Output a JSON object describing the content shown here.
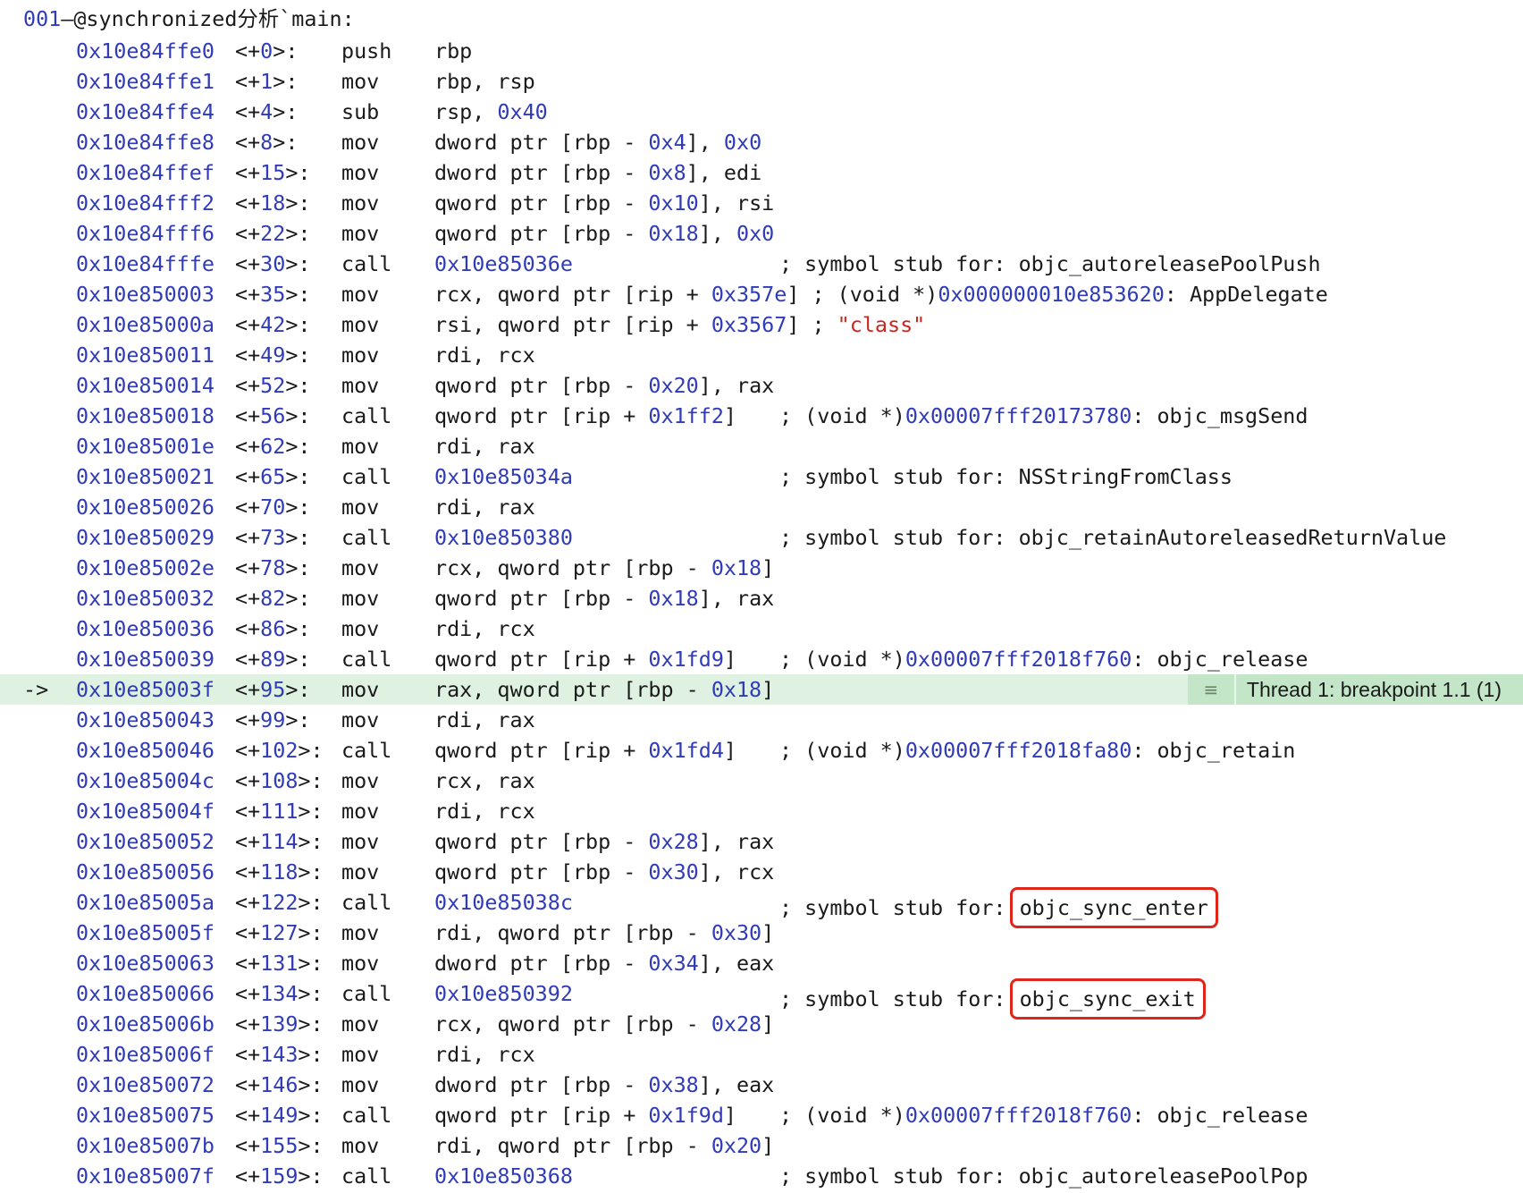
{
  "header": {
    "prefix": "001",
    "label": "—@synchronized分析`main:"
  },
  "current_arrow": "->",
  "breakpoint": {
    "icon": "≡",
    "label": "Thread 1: breakpoint 1.1 (1)"
  },
  "lines": [
    {
      "addr": "0x10e84ffe0",
      "off": "0",
      "mn": "push",
      "op": [
        [
          "rbp"
        ]
      ],
      "cm": []
    },
    {
      "addr": "0x10e84ffe1",
      "off": "1",
      "mn": "mov",
      "op": [
        [
          "rbp, rsp"
        ]
      ],
      "cm": []
    },
    {
      "addr": "0x10e84ffe4",
      "off": "4",
      "mn": "sub",
      "op": [
        [
          "rsp, "
        ],
        [
          "0x40",
          "h"
        ]
      ],
      "cm": []
    },
    {
      "addr": "0x10e84ffe8",
      "off": "8",
      "mn": "mov",
      "op": [
        [
          "dword ptr [rbp - "
        ],
        [
          "0x4",
          "h"
        ],
        [
          "], "
        ],
        [
          "0x0",
          "h"
        ]
      ],
      "cm": []
    },
    {
      "addr": "0x10e84ffef",
      "off": "15",
      "mn": "mov",
      "op": [
        [
          "dword ptr [rbp - "
        ],
        [
          "0x8",
          "h"
        ],
        [
          "], edi"
        ]
      ],
      "cm": []
    },
    {
      "addr": "0x10e84fff2",
      "off": "18",
      "mn": "mov",
      "op": [
        [
          "qword ptr [rbp - "
        ],
        [
          "0x10",
          "h"
        ],
        [
          "], rsi"
        ]
      ],
      "cm": []
    },
    {
      "addr": "0x10e84fff6",
      "off": "22",
      "mn": "mov",
      "op": [
        [
          "qword ptr [rbp - "
        ],
        [
          "0x18",
          "h"
        ],
        [
          "], "
        ],
        [
          "0x0",
          "h"
        ]
      ],
      "cm": []
    },
    {
      "addr": "0x10e84fffe",
      "off": "30",
      "mn": "call",
      "op": [
        [
          "0x10e85036e",
          "h"
        ]
      ],
      "cm": [
        [
          "; symbol stub for: objc_autoreleasePoolPush"
        ]
      ]
    },
    {
      "addr": "0x10e850003",
      "off": "35",
      "mn": "mov",
      "op": [
        [
          "rcx, qword ptr [rip + "
        ],
        [
          "0x357e",
          "h"
        ],
        [
          "] ; (void *)"
        ],
        [
          "0x000000010e853620",
          "h"
        ],
        [
          ": AppDelegate"
        ]
      ],
      "cm": []
    },
    {
      "addr": "0x10e85000a",
      "off": "42",
      "mn": "mov",
      "op": [
        [
          "rsi, qword ptr [rip + "
        ],
        [
          "0x3567",
          "h"
        ],
        [
          "] ; "
        ],
        [
          "\"class\"",
          "s"
        ]
      ],
      "cm": []
    },
    {
      "addr": "0x10e850011",
      "off": "49",
      "mn": "mov",
      "op": [
        [
          "rdi, rcx"
        ]
      ],
      "cm": []
    },
    {
      "addr": "0x10e850014",
      "off": "52",
      "mn": "mov",
      "op": [
        [
          "qword ptr [rbp - "
        ],
        [
          "0x20",
          "h"
        ],
        [
          "], rax"
        ]
      ],
      "cm": []
    },
    {
      "addr": "0x10e850018",
      "off": "56",
      "mn": "call",
      "op": [
        [
          "qword ptr [rip + "
        ],
        [
          "0x1ff2",
          "h"
        ],
        [
          "]"
        ]
      ],
      "cm": [
        [
          "; (void *)"
        ],
        [
          "0x00007fff20173780",
          "h"
        ],
        [
          ": objc_msgSend"
        ]
      ]
    },
    {
      "addr": "0x10e85001e",
      "off": "62",
      "mn": "mov",
      "op": [
        [
          "rdi, rax"
        ]
      ],
      "cm": []
    },
    {
      "addr": "0x10e850021",
      "off": "65",
      "mn": "call",
      "op": [
        [
          "0x10e85034a",
          "h"
        ]
      ],
      "cm": [
        [
          "; symbol stub for: NSStringFromClass"
        ]
      ]
    },
    {
      "addr": "0x10e850026",
      "off": "70",
      "mn": "mov",
      "op": [
        [
          "rdi, rax"
        ]
      ],
      "cm": []
    },
    {
      "addr": "0x10e850029",
      "off": "73",
      "mn": "call",
      "op": [
        [
          "0x10e850380",
          "h"
        ]
      ],
      "cm": [
        [
          "; symbol stub for: objc_retainAutoreleasedReturnValue"
        ]
      ]
    },
    {
      "addr": "0x10e85002e",
      "off": "78",
      "mn": "mov",
      "op": [
        [
          "rcx, qword ptr [rbp - "
        ],
        [
          "0x18",
          "h"
        ],
        [
          "]"
        ]
      ],
      "cm": []
    },
    {
      "addr": "0x10e850032",
      "off": "82",
      "mn": "mov",
      "op": [
        [
          "qword ptr [rbp - "
        ],
        [
          "0x18",
          "h"
        ],
        [
          "], rax"
        ]
      ],
      "cm": []
    },
    {
      "addr": "0x10e850036",
      "off": "86",
      "mn": "mov",
      "op": [
        [
          "rdi, rcx"
        ]
      ],
      "cm": []
    },
    {
      "addr": "0x10e850039",
      "off": "89",
      "mn": "call",
      "op": [
        [
          "qword ptr [rip + "
        ],
        [
          "0x1fd9",
          "h"
        ],
        [
          "]"
        ]
      ],
      "cm": [
        [
          "; (void *)"
        ],
        [
          "0x00007fff2018f760",
          "h"
        ],
        [
          ": objc_release"
        ]
      ]
    },
    {
      "addr": "0x10e85003f",
      "off": "95",
      "mn": "mov",
      "op": [
        [
          "rax, qword ptr [rbp - "
        ],
        [
          "0x18",
          "h"
        ],
        [
          "]"
        ]
      ],
      "cm": [],
      "current": true
    },
    {
      "addr": "0x10e850043",
      "off": "99",
      "mn": "mov",
      "op": [
        [
          "rdi, rax"
        ]
      ],
      "cm": []
    },
    {
      "addr": "0x10e850046",
      "off": "102",
      "mn": "call",
      "op": [
        [
          "qword ptr [rip + "
        ],
        [
          "0x1fd4",
          "h"
        ],
        [
          "]"
        ]
      ],
      "cm": [
        [
          "; (void *)"
        ],
        [
          "0x00007fff2018fa80",
          "h"
        ],
        [
          ": objc_retain"
        ]
      ]
    },
    {
      "addr": "0x10e85004c",
      "off": "108",
      "mn": "mov",
      "op": [
        [
          "rcx, rax"
        ]
      ],
      "cm": []
    },
    {
      "addr": "0x10e85004f",
      "off": "111",
      "mn": "mov",
      "op": [
        [
          "rdi, rcx"
        ]
      ],
      "cm": []
    },
    {
      "addr": "0x10e850052",
      "off": "114",
      "mn": "mov",
      "op": [
        [
          "qword ptr [rbp - "
        ],
        [
          "0x28",
          "h"
        ],
        [
          "], rax"
        ]
      ],
      "cm": []
    },
    {
      "addr": "0x10e850056",
      "off": "118",
      "mn": "mov",
      "op": [
        [
          "qword ptr [rbp - "
        ],
        [
          "0x30",
          "h"
        ],
        [
          "], rcx"
        ]
      ],
      "cm": []
    },
    {
      "addr": "0x10e85005a",
      "off": "122",
      "mn": "call",
      "op": [
        [
          "0x10e85038c",
          "h"
        ]
      ],
      "cm": [
        [
          "; symbol stub for: "
        ],
        [
          "objc_sync_enter",
          "hl"
        ]
      ]
    },
    {
      "addr": "0x10e85005f",
      "off": "127",
      "mn": "mov",
      "op": [
        [
          "rdi, qword ptr [rbp - "
        ],
        [
          "0x30",
          "h"
        ],
        [
          "]"
        ]
      ],
      "cm": []
    },
    {
      "addr": "0x10e850063",
      "off": "131",
      "mn": "mov",
      "op": [
        [
          "dword ptr [rbp - "
        ],
        [
          "0x34",
          "h"
        ],
        [
          "], eax"
        ]
      ],
      "cm": []
    },
    {
      "addr": "0x10e850066",
      "off": "134",
      "mn": "call",
      "op": [
        [
          "0x10e850392",
          "h"
        ]
      ],
      "cm": [
        [
          "; symbol stub for: "
        ],
        [
          "objc_sync_exit",
          "hl"
        ]
      ]
    },
    {
      "addr": "0x10e85006b",
      "off": "139",
      "mn": "mov",
      "op": [
        [
          "rcx, qword ptr [rbp - "
        ],
        [
          "0x28",
          "h"
        ],
        [
          "]"
        ]
      ],
      "cm": []
    },
    {
      "addr": "0x10e85006f",
      "off": "143",
      "mn": "mov",
      "op": [
        [
          "rdi, rcx"
        ]
      ],
      "cm": []
    },
    {
      "addr": "0x10e850072",
      "off": "146",
      "mn": "mov",
      "op": [
        [
          "dword ptr [rbp - "
        ],
        [
          "0x38",
          "h"
        ],
        [
          "], eax"
        ]
      ],
      "cm": []
    },
    {
      "addr": "0x10e850075",
      "off": "149",
      "mn": "call",
      "op": [
        [
          "qword ptr [rip + "
        ],
        [
          "0x1f9d",
          "h"
        ],
        [
          "]"
        ]
      ],
      "cm": [
        [
          "; (void *)"
        ],
        [
          "0x00007fff2018f760",
          "h"
        ],
        [
          ": objc_release"
        ]
      ]
    },
    {
      "addr": "0x10e85007b",
      "off": "155",
      "mn": "mov",
      "op": [
        [
          "rdi, qword ptr [rbp - "
        ],
        [
          "0x20",
          "h"
        ],
        [
          "]"
        ]
      ],
      "cm": []
    },
    {
      "addr": "0x10e85007f",
      "off": "159",
      "mn": "call",
      "op": [
        [
          "0x10e850368",
          "h"
        ]
      ],
      "cm": [
        [
          "; symbol stub for: objc_autoreleasePoolPop"
        ]
      ]
    }
  ]
}
